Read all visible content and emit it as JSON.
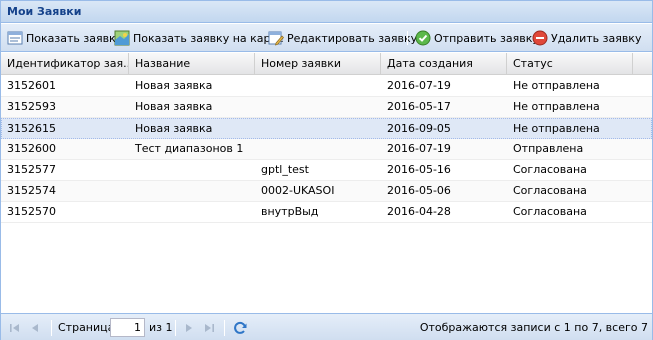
{
  "panel": {
    "title": "Мои Заявки"
  },
  "toolbar": {
    "show_request": {
      "label": "Показать заявку",
      "icon": "form-icon"
    },
    "show_on_map": {
      "label": "Показать заявку на карте",
      "icon": "map-icon"
    },
    "edit_request": {
      "label": "Редактировать заявку",
      "icon": "edit-form-icon"
    },
    "send_request": {
      "label": "Отправить заявку",
      "icon": "check-circle-icon"
    },
    "delete_request": {
      "label": "Удалить заявку",
      "icon": "delete-circle-icon"
    }
  },
  "grid": {
    "columns": [
      "Идентификатор зая...",
      "Название",
      "Номер заявки",
      "Дата создания",
      "Статус"
    ],
    "rows": [
      [
        "3152601",
        "Новая заявка",
        "",
        "2016-07-19",
        "Не отправлена"
      ],
      [
        "3152593",
        "Новая заявка",
        "",
        "2016-05-17",
        "Не отправлена"
      ],
      [
        "3152615",
        "Новая заявка",
        "",
        "2016-09-05",
        "Не отправлена"
      ],
      [
        "3152600",
        "Тест диапазонов 1",
        "",
        "2016-07-19",
        "Отправлена"
      ],
      [
        "3152577",
        "",
        "gptl_test",
        "2016-05-16",
        "Согласована"
      ],
      [
        "3152574",
        "",
        "0002-UKASOI",
        "2016-05-06",
        "Согласована"
      ],
      [
        "3152570",
        "",
        "внутрВыд",
        "2016-04-28",
        "Согласована"
      ]
    ],
    "selected_row": 2
  },
  "pager": {
    "page_label": "Страница",
    "page_value": "1",
    "of_label": "из 1",
    "info": "Отображаются записи с 1 по 7, всего 7"
  },
  "colors": {
    "title": "#15428b",
    "border": "#99bbe8",
    "selected": "#dfe8f6"
  }
}
